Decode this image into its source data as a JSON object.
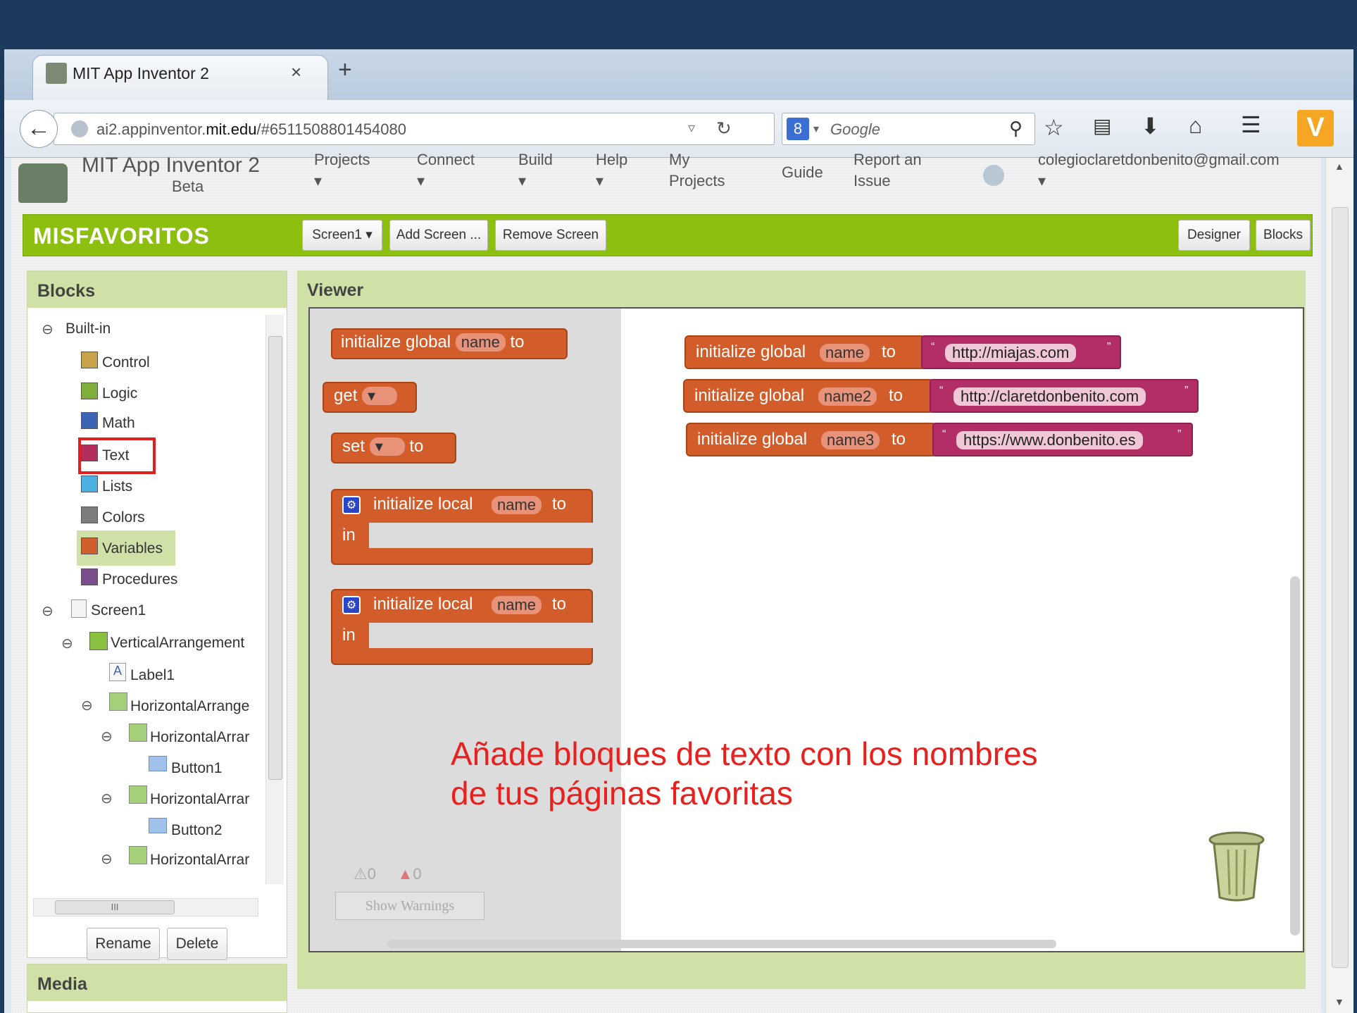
{
  "browser": {
    "tab_title": "MIT App Inventor 2",
    "tab_close": "×",
    "new_tab": "+",
    "url_domain_pre": "ai2.appinventor.",
    "url_domain_bold": "mit.edu",
    "url_path": "/#6511508801454080",
    "search_placeholder": "Google",
    "search_engine_badge": "8"
  },
  "app_menu": {
    "brand": "MIT App Inventor 2",
    "beta": "Beta",
    "projects": "Projects",
    "connect": "Connect",
    "build": "Build",
    "help": "Help",
    "my_projects_1": "My",
    "my_projects_2": "Projects",
    "guide": "Guide",
    "report_1": "Report an",
    "report_2": "Issue",
    "account": "colegioclaretdonbenito@gmail.com",
    "caret": "▾"
  },
  "toolbar": {
    "project_name": "MISFAVORITOS",
    "screen_select": "Screen1 ▾",
    "add_screen": "Add Screen ...",
    "remove_screen": "Remove Screen",
    "designer": "Designer",
    "blocks": "Blocks"
  },
  "blocks_panel": {
    "title": "Blocks",
    "builtin": "Built-in",
    "categories": [
      {
        "label": "Control",
        "color": "#c8a24a"
      },
      {
        "label": "Logic",
        "color": "#7fae3a"
      },
      {
        "label": "Math",
        "color": "#3c64b4"
      },
      {
        "label": "Text",
        "color": "#b32d5e"
      },
      {
        "label": "Lists",
        "color": "#4cb0e0"
      },
      {
        "label": "Colors",
        "color": "#7d7d7d"
      },
      {
        "label": "Variables",
        "color": "#d05f2d"
      },
      {
        "label": "Procedures",
        "color": "#7c4d8c"
      }
    ],
    "components": {
      "screen": "Screen1",
      "vertical": "VerticalArrangement",
      "label1": "Label1",
      "horizontal_long": "HorizontalArrange",
      "horizontal_a": "HorizontalArrar",
      "button1": "Button1",
      "horizontal_b": "HorizontalArrar",
      "button2": "Button2",
      "horizontal_c": "HorizontalArrar"
    },
    "hscroll_grip": "III",
    "rename": "Rename",
    "delete": "Delete"
  },
  "media_panel": {
    "title": "Media"
  },
  "viewer": {
    "title": "Viewer",
    "flyout": {
      "init_global": "initialize global",
      "name": "name",
      "to": "to",
      "get": "get",
      "set": "set",
      "init_local": "initialize local",
      "in": "in"
    },
    "workspace_blocks": [
      {
        "prefix": "initialize global",
        "var": "name",
        "to": "to",
        "text": "http://miajas.com"
      },
      {
        "prefix": "initialize global",
        "var": "name2",
        "to": "to",
        "text": "http://claretdonbenito.com"
      },
      {
        "prefix": "initialize global",
        "var": "name3",
        "to": "to",
        "text": "https://www.donbenito.es"
      }
    ],
    "quote_open": "“",
    "quote_close": "”",
    "annotation_line1": "Añade bloques de texto con los nombres",
    "annotation_line2": "de tus páginas favoritas",
    "warnings_count": "0",
    "errors_count": "0",
    "show_warnings": "Show Warnings"
  },
  "colors": {
    "title_bar": "#1b3a5e",
    "app_green": "#8cbf0f",
    "variable_block": "#d25d2a",
    "text_block": "#b32d66",
    "highlight_red": "#e8201e"
  }
}
